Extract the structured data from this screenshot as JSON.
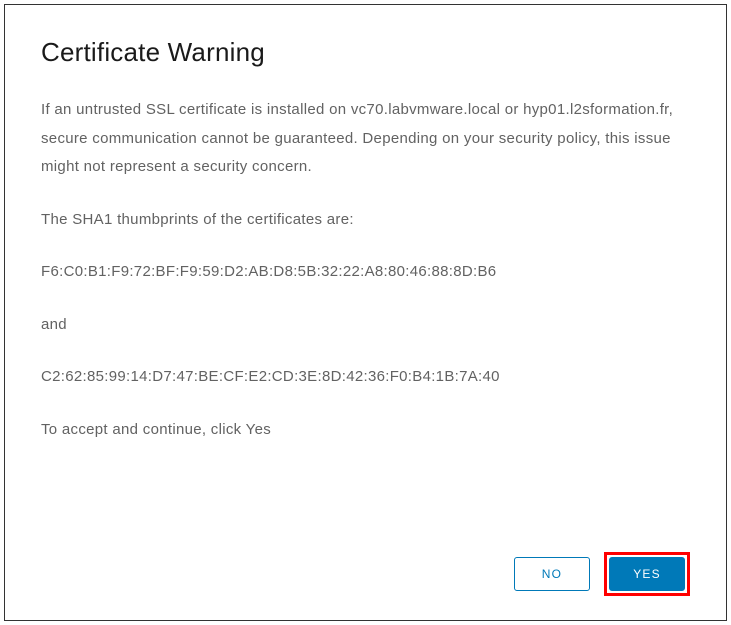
{
  "dialog": {
    "title": "Certificate Warning",
    "body": {
      "warning_text": "If an untrusted SSL certificate is installed on vc70.labvmware.local or hyp01.l2sformation.fr, secure communication cannot be guaranteed. Depending on your security policy, this issue might not represent a security concern.",
      "thumbprint_intro": "The SHA1 thumbprints of the certificates are:",
      "thumbprint1": "F6:C0:B1:F9:72:BF:F9:59:D2:AB:D8:5B:32:22:A8:80:46:88:8D:B6",
      "connector": "and",
      "thumbprint2": "C2:62:85:99:14:D7:47:BE:CF:E2:CD:3E:8D:42:36:F0:B4:1B:7A:40",
      "accept_text": "To accept and continue, click Yes"
    },
    "buttons": {
      "no_label": "No",
      "yes_label": "Yes"
    }
  }
}
